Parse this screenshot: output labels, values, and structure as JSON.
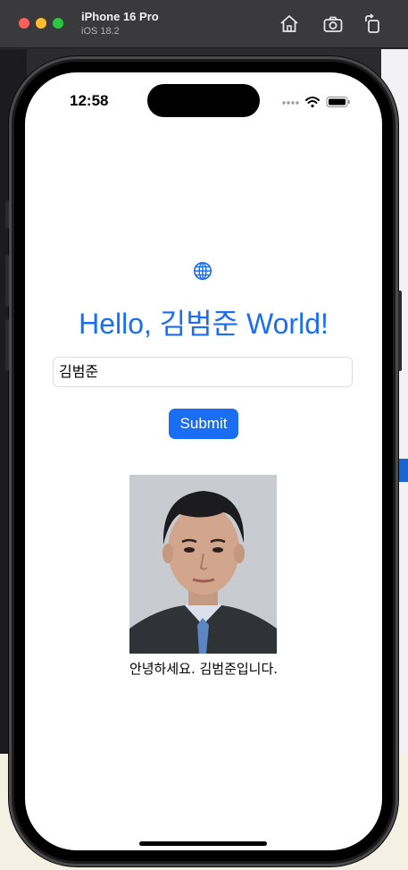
{
  "simulator": {
    "device_name": "iPhone 16 Pro",
    "os_version": "iOS 18.2",
    "toolbar_icons": [
      "home-icon",
      "screenshot-camera-icon",
      "rotate-icon"
    ]
  },
  "status_bar": {
    "time": "12:58"
  },
  "app": {
    "heading": "Hello, 김범준 World!",
    "name_input": {
      "value": "김범준",
      "placeholder": ""
    },
    "submit_label": "Submit",
    "photo_alt": "김범준",
    "greeting": "안녕하세요. 김범준입니다."
  },
  "colors": {
    "accent": "#1a6ef3"
  }
}
